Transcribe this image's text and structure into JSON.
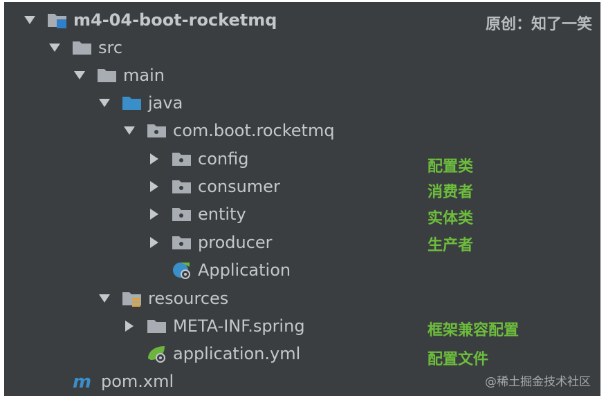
{
  "header": {
    "credit": "原创：知了一笑"
  },
  "tree": {
    "root": {
      "label": "m4-04-boot-rocketmq",
      "icon": "module-folder-icon",
      "expanded": true
    },
    "src": {
      "label": "src",
      "icon": "folder-icon",
      "expanded": true
    },
    "main": {
      "label": "main",
      "icon": "folder-icon",
      "expanded": true
    },
    "java": {
      "label": "java",
      "icon": "source-root-folder-icon",
      "expanded": true
    },
    "package": {
      "label": "com.boot.rocketmq",
      "icon": "package-folder-icon",
      "expanded": true
    },
    "config": {
      "label": "config",
      "icon": "package-folder-icon",
      "expanded": false
    },
    "consumer": {
      "label": "consumer",
      "icon": "package-folder-icon",
      "expanded": false
    },
    "entity": {
      "label": "entity",
      "icon": "package-folder-icon",
      "expanded": false
    },
    "producer": {
      "label": "producer",
      "icon": "package-folder-icon",
      "expanded": false
    },
    "application": {
      "label": "Application",
      "icon": "spring-boot-class-icon"
    },
    "resources": {
      "label": "resources",
      "icon": "resources-folder-icon",
      "expanded": true
    },
    "metainf": {
      "label": "META-INF.spring",
      "icon": "folder-icon",
      "expanded": false
    },
    "appyml": {
      "label": "application.yml",
      "icon": "spring-config-file-icon"
    },
    "pom": {
      "label": "pom.xml",
      "icon": "maven-icon"
    }
  },
  "annotations": {
    "config": "配置类",
    "consumer": "消费者",
    "entity": "实体类",
    "producer": "生产者",
    "metainf": "框架兼容配置",
    "appyml": "配置文件"
  },
  "watermark": "@稀土掘金技术社区",
  "colors": {
    "panel_bg": "#3b3e40",
    "text": "#c5c8cb",
    "annotation_green": "#6dbd3d",
    "folder_gray": "#a7adb2",
    "source_blue": "#3a8ec9",
    "spring_green": "#6db33f"
  }
}
